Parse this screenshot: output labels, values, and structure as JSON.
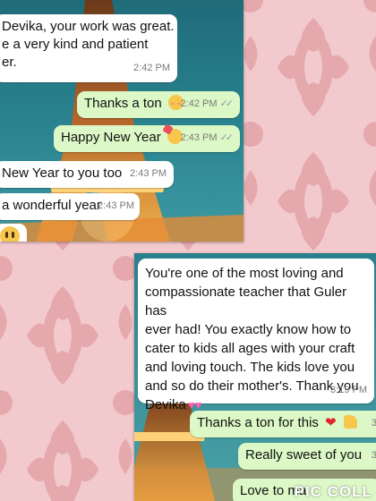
{
  "screenshot1": {
    "messages": [
      {
        "lines": [
          "Devika, your work was great.",
          "e a very kind and patient",
          "er."
        ],
        "time": "2:42 PM",
        "direction": "incoming"
      },
      {
        "text": "Thanks a ton",
        "emoji": "smiling-face-with-blush",
        "time": "2:42 PM",
        "direction": "outgoing"
      },
      {
        "text": "Happy New Year",
        "emoji": "partying-face",
        "time": "2:43 PM",
        "direction": "outgoing"
      },
      {
        "text": "New Year to you too",
        "time": "2:43 PM",
        "direction": "incoming"
      },
      {
        "text": "a wonderful year",
        "time": "2:43 PM",
        "direction": "incoming"
      },
      {
        "emoji": "grinning-face",
        "direction": "incoming"
      }
    ]
  },
  "screenshot2": {
    "messages": [
      {
        "lines": [
          "You're one of the most loving and",
          "compassionate teacher that Guler has",
          "ever had! You exactly know how to",
          "cater to kids all ages with your craft",
          "and loving touch. The kids love you",
          "and so do their mother's. Thank you",
          "Devika"
        ],
        "emoji": "two-hearts",
        "time": "3:19 PM",
        "direction": "incoming"
      },
      {
        "text": "Thanks a ton for this",
        "emoji": "red-heart,thumbs-up",
        "time": "3:",
        "direction": "outgoing"
      },
      {
        "text": "Really sweet of you",
        "time": "3:",
        "direction": "outgoing"
      },
      {
        "text": "Love to ma",
        "direction": "outgoing"
      }
    ]
  },
  "watermark": "PIC COLL",
  "colors": {
    "background": "#f2c9cc",
    "incoming": "#ffffff",
    "outgoing": "#dcf8c6",
    "heart": "#e0272f"
  }
}
